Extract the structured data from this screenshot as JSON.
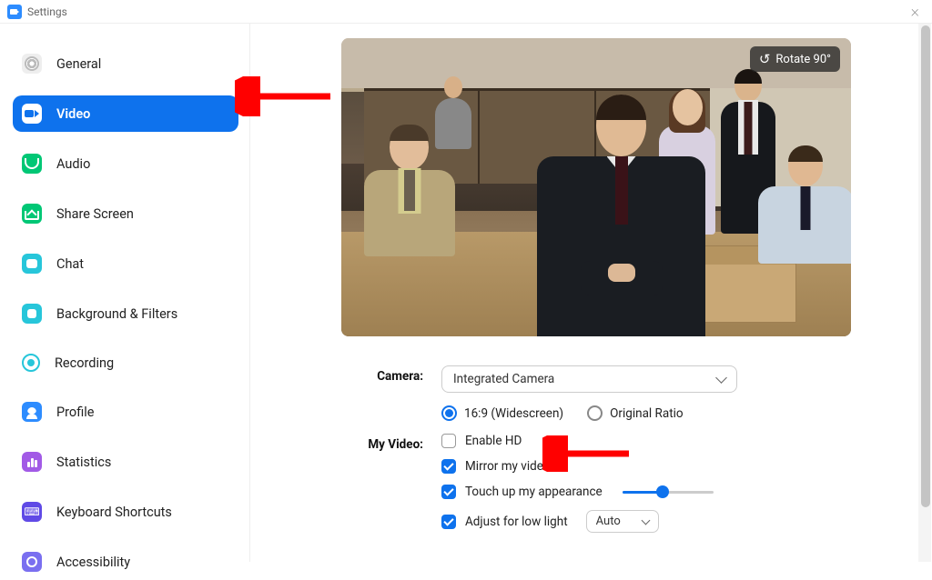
{
  "titlebar": {
    "title": "Settings"
  },
  "sidebar": {
    "items": [
      {
        "label": "General"
      },
      {
        "label": "Video"
      },
      {
        "label": "Audio"
      },
      {
        "label": "Share Screen"
      },
      {
        "label": "Chat"
      },
      {
        "label": "Background & Filters"
      },
      {
        "label": "Recording"
      },
      {
        "label": "Profile"
      },
      {
        "label": "Statistics"
      },
      {
        "label": "Keyboard Shortcuts"
      },
      {
        "label": "Accessibility"
      }
    ]
  },
  "preview": {
    "rotate_label": "Rotate 90°"
  },
  "settings": {
    "camera_label": "Camera:",
    "camera_value": "Integrated Camera",
    "ratio_widescreen": "16:9 (Widescreen)",
    "ratio_original": "Original Ratio",
    "myvideo_label": "My Video:",
    "enable_hd": "Enable HD",
    "mirror": "Mirror my video",
    "touchup": "Touch up my appearance",
    "lowlight": "Adjust for low light",
    "lowlight_mode": "Auto"
  }
}
